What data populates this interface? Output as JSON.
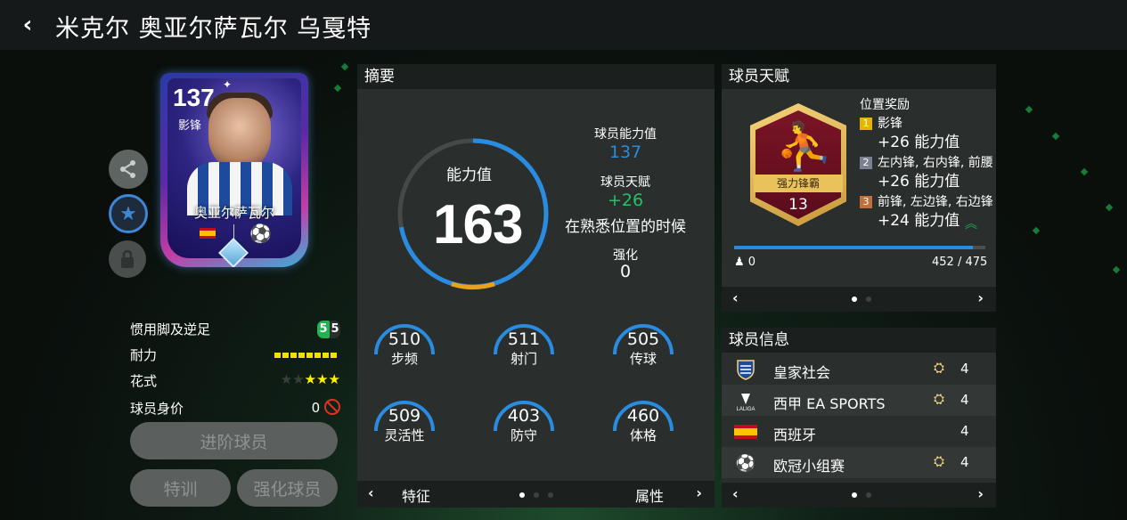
{
  "header": {
    "title": "米克尔 奥亚尔萨瓦尔 乌戛特"
  },
  "card": {
    "ovr": "137",
    "position": "影锋",
    "name": "奥亚尔萨瓦尔",
    "colors": {
      "frame_start": "#2a3aa8",
      "frame_end": "#3ab0d8"
    }
  },
  "attributes": {
    "weak_foot_label": "惯用脚及逆足",
    "weak_foot_a": "5",
    "weak_foot_b": "5",
    "stamina_label": "耐力",
    "skill_moves_label": "花式",
    "skill_moves_stars": 3,
    "skill_moves_max": 5,
    "value_label": "球员身价",
    "value": "0"
  },
  "buttons": {
    "upgrade": "进阶球员",
    "training": "特训",
    "enhance": "强化球员"
  },
  "summary": {
    "title": "摘要",
    "ring_label": "能力值",
    "ovr": "163",
    "ring_level": 0.72,
    "base_label": "球员能力值",
    "base_value": "137",
    "trait_label": "球员天赋",
    "trait_value": "+26",
    "trait_note": "在熟悉位置的时候",
    "enhance_label": "强化",
    "enhance_value": "0",
    "stats": [
      {
        "value": "510",
        "name": "步频"
      },
      {
        "value": "511",
        "name": "射门"
      },
      {
        "value": "505",
        "name": "传球"
      },
      {
        "value": "509",
        "name": "灵活性"
      },
      {
        "value": "403",
        "name": "防守"
      },
      {
        "value": "460",
        "name": "体格"
      }
    ],
    "pager_left": "特征",
    "pager_right": "属性",
    "arrow_left": "‹",
    "arrow_right": "›"
  },
  "traits": {
    "title": "球员天赋",
    "badge_name": "强力锋霸",
    "badge_level": "13",
    "reward_title": "位置奖励",
    "rewards": [
      {
        "rank": "1",
        "positions": "影锋",
        "bonus": "+26 能力值",
        "color": "#e6b400"
      },
      {
        "rank": "2",
        "positions": "左内锋, 右内锋, 前腰",
        "bonus": "+26 能力值",
        "color": "#7b8190"
      },
      {
        "rank": "3",
        "positions": "前锋, 左边锋, 右边锋",
        "bonus": "+24 能力值",
        "color": "#c0703a"
      }
    ],
    "boost_count": "0",
    "progress_text": "452 / 475",
    "progress_fraction": 0.95
  },
  "info": {
    "title": "球员信息",
    "rows": [
      {
        "name": "皇家社会",
        "count": "4"
      },
      {
        "name": "西甲 EA SPORTS",
        "count": "4"
      },
      {
        "name": "西班牙",
        "count": "4"
      },
      {
        "name": "欧冠小组赛",
        "count": "4"
      }
    ]
  }
}
